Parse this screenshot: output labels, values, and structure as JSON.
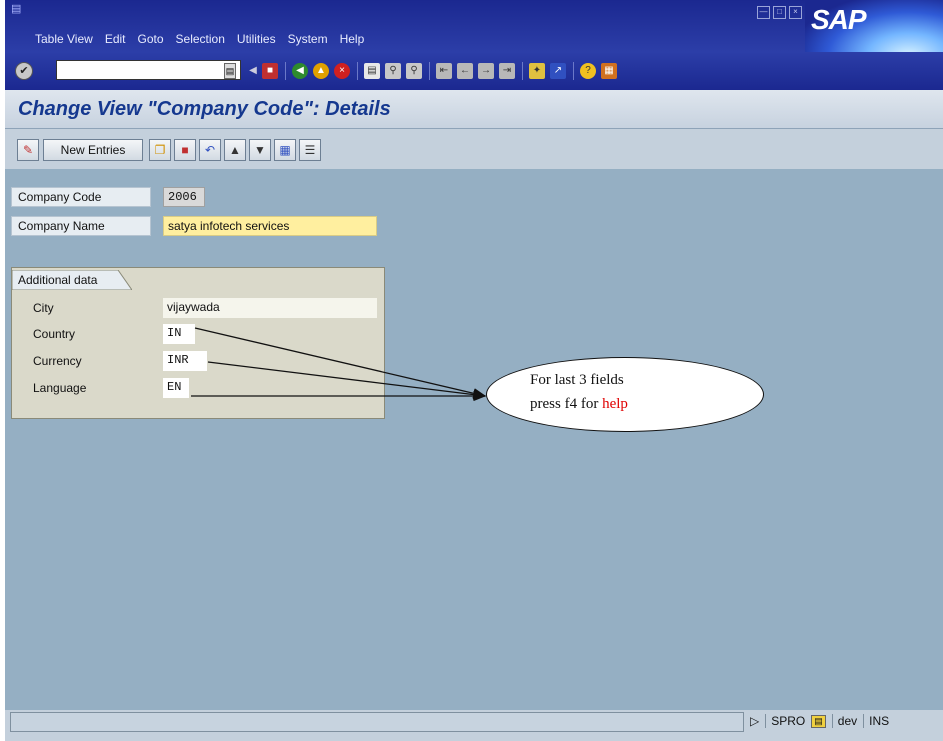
{
  "menubar": {
    "items": [
      {
        "label": "Table View"
      },
      {
        "label": "Edit"
      },
      {
        "label": "Goto"
      },
      {
        "label": "Selection"
      },
      {
        "label": "Utilities"
      },
      {
        "label": "System"
      },
      {
        "label": "Help"
      }
    ],
    "logo_text": "SAP"
  },
  "toolbar": {
    "command_field_value": ""
  },
  "page": {
    "title": "Change View \"Company Code\": Details"
  },
  "app_toolbar": {
    "new_entries_label": "New Entries"
  },
  "fields": {
    "company_code_label": "Company Code",
    "company_code_value": "2006",
    "company_name_label": "Company Name",
    "company_name_value": "satya infotech  services"
  },
  "additional_data": {
    "tab_label": "Additional data",
    "city_label": "City",
    "city_value": "vijaywada",
    "country_label": "Country",
    "country_value": "IN",
    "currency_label": "Currency",
    "currency_value": "INR",
    "language_label": "Language",
    "language_value": "EN"
  },
  "callout": {
    "line1": "For last 3 fields",
    "line2_prefix": "press f4 for ",
    "line2_highlight": "help"
  },
  "statusbar": {
    "transaction": "SPRO",
    "system": "dev",
    "mode": "INS"
  },
  "colors": {
    "menubar": "#1b2890",
    "background": "#95afc3",
    "title": "#15388f",
    "highlight_field": "#ffef9f",
    "help_text": "#e00000"
  }
}
